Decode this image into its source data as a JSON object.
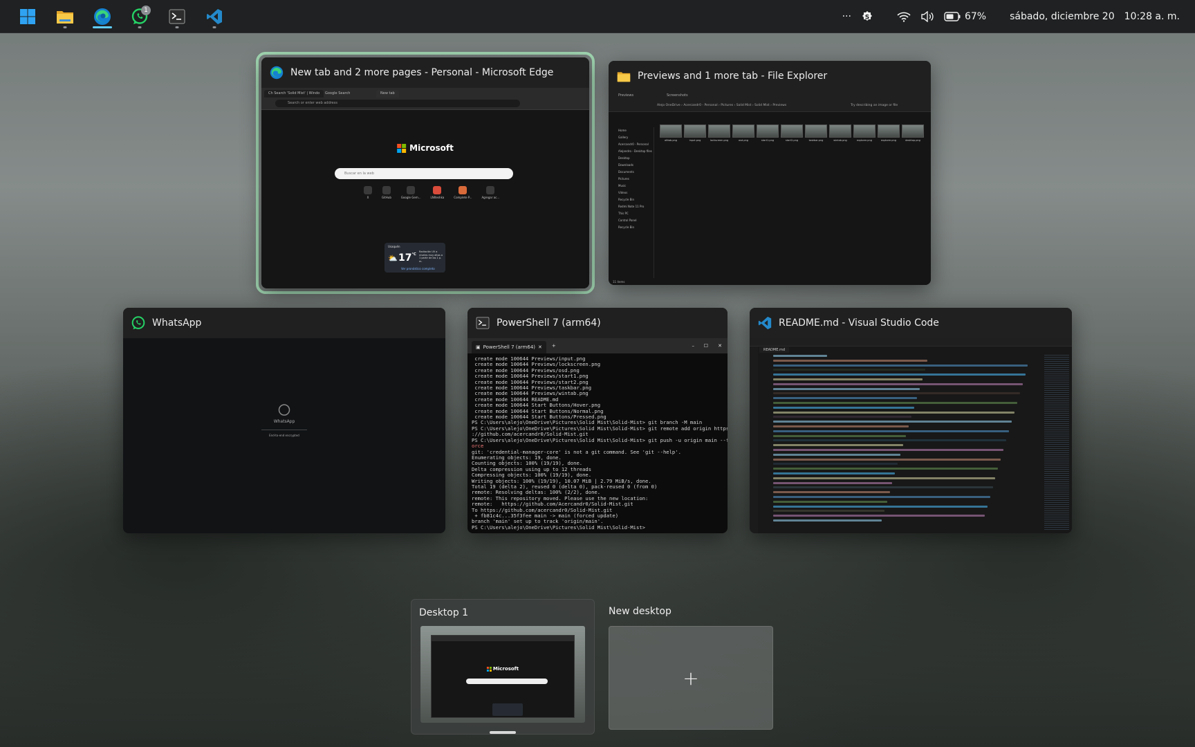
{
  "taskbar": {
    "apps": [
      {
        "name": "start",
        "icon": "windows-icon"
      },
      {
        "name": "file-explorer",
        "icon": "folder-icon"
      },
      {
        "name": "edge",
        "icon": "edge-icon",
        "active": true
      },
      {
        "name": "whatsapp",
        "icon": "whatsapp-icon",
        "badge": "1"
      },
      {
        "name": "terminal",
        "icon": "terminal-icon"
      },
      {
        "name": "vscode",
        "icon": "vscode-icon"
      }
    ],
    "tray": {
      "overflow": "···",
      "battery_percent": "67%",
      "date": "sábado, diciembre 20",
      "time": "10:28 a. m."
    }
  },
  "windows": {
    "edge": {
      "title": "New tab and 2 more pages - Personal - Microsoft Edge",
      "preview": {
        "tabs": [
          "Ch Search 'Solid Mist' | Windo",
          "Google Search",
          "New tab"
        ],
        "address_placeholder": "Search or enter web address",
        "logo_text": "Microsoft",
        "search_placeholder": "Buscar en la web",
        "shortcuts": [
          "X",
          "GitHub",
          "Google Gem...",
          "LNIteshka",
          "Complete P...",
          "Agregar ac..."
        ],
        "weather": {
          "location": "Usaquén",
          "temp": "17",
          "unit": "°C",
          "note": "Radiación UV a niveles muy altos a 1 partir de las 1 p. m.",
          "link": "Ver pronóstico completo"
        }
      }
    },
    "explorer": {
      "title": "Previews and 1 more tab - File Explorer",
      "preview": {
        "tabs": [
          "Previews",
          "Screenshots"
        ],
        "breadcrumb": "Alejo OneDrive  ›  Acercandr0 - Personal  ›  Pictures  ›  Solid Mist  ›  Solid Mist  ›  Previews",
        "search_placeholder": "Try describing an image or file",
        "sidebar": [
          "Home",
          "Gallery",
          "Acercandr0 - Personal",
          "Alejandro - Desktop files",
          "Desktop",
          "Downloads",
          "Documents",
          "Pictures",
          "Music",
          "Videos",
          "Recycle Bin",
          "Redmi Note 11 Pro",
          "This PC",
          "Control Panel",
          "Recycle Bin"
        ],
        "files": [
          "alttab.png",
          "input.png",
          "lockscreen.png",
          "osd.png",
          "start1.png",
          "start2.png",
          "taskbar.png",
          "wintab.png",
          "explorer.png",
          "explorer.png",
          "desktop.png"
        ],
        "status": "11 items"
      }
    },
    "whatsapp": {
      "title": "WhatsApp",
      "preview": {
        "logo_text": "WhatsApp",
        "footer": "End-to-end encrypted"
      }
    },
    "powershell": {
      "title": "PowerShell 7 (arm64)",
      "preview": {
        "tab_label": "PowerShell 7 (arm64)",
        "lines": [
          " create mode 100644 Previews/input.png",
          " create mode 100644 Previews/lockscreen.png",
          " create mode 100644 Previews/osd.png",
          " create mode 100644 Previews/start1.png",
          " create mode 100644 Previews/start2.png",
          " create mode 100644 Previews/taskbar.png",
          " create mode 100644 Previews/wintab.png",
          " create mode 100644 README.md",
          " create mode 100644 Start Buttons/Hover.png",
          " create mode 100644 Start Buttons/Normal.png",
          " create mode 100644 Start Buttons/Pressed.png",
          "PS C:\\Users\\alejo\\OneDrive\\Pictures\\Solid Mist\\Solid-Mist> git branch -M main",
          "PS C:\\Users\\alejo\\OneDrive\\Pictures\\Solid Mist\\Solid-Mist> git remote add origin https",
          "://github.com/acercandr0/Solid-Mist.git",
          "PS C:\\Users\\alejo\\OneDrive\\Pictures\\Solid Mist\\Solid-Mist> git push -u origin main --f",
          "orce",
          "git: 'credential-manager-core' is not a git command. See 'git --help'.",
          "Enumerating objects: 19, done.",
          "Counting objects: 100% (19/19), done.",
          "Delta compression using up to 12 threads",
          "Compressing objects: 100% (19/19), done.",
          "Writing objects: 100% (19/19), 10.07 MiB | 2.79 MiB/s, done.",
          "Total 19 (delta 2), reused 0 (delta 0), pack-reused 0 (from 0)",
          "remote: Resolving deltas: 100% (2/2), done.",
          "remote: This repository moved. Please use the new location:",
          "remote:   https://github.com/Acercandr0/Solid-Mist.git",
          "To https://github.com/acercandr0/Solid-Mist.git",
          " + fb81c4c...35f3fee main -> main (forced update)",
          "branch 'main' set up to track 'origin/main'.",
          "PS C:\\Users\\alejo\\OneDrive\\Pictures\\Solid Mist\\Solid-Mist>"
        ]
      }
    },
    "vscode": {
      "title": "README.md - Visual Studio Code",
      "preview": {
        "file_tab": "README.md"
      }
    }
  },
  "desktops": {
    "current": "Desktop 1",
    "new_label": "New desktop",
    "add_symbol": "+"
  },
  "colors": {
    "focus_ring": "#a3d9b4",
    "accent": "#60cdff",
    "whatsapp": "#25d366",
    "edge_blue": "#1a8fd9",
    "folder_yellow": "#f3c03d",
    "vscode_blue": "#2489ca"
  }
}
